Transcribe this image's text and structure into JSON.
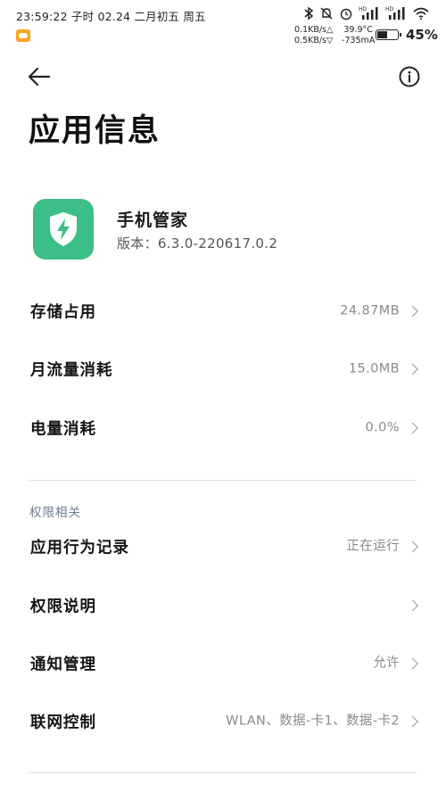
{
  "status_bar": {
    "datetime": "23:59:22 子时 02.24 二月初五 周五",
    "upload_speed": "0.1KB/s△",
    "download_speed": "0.5KB/s▽",
    "temperature": "39.9°C",
    "current": "-735mA",
    "battery_percent": "45%",
    "battery_level": 0.45,
    "icons": [
      "bluetooth-icon",
      "mute-icon",
      "alarm-icon",
      "hd-signal-icon",
      "hd-signal-icon",
      "wifi-icon"
    ],
    "status_icon_labels": [
      "HD",
      "HD"
    ]
  },
  "header": {
    "title": "应用信息"
  },
  "app": {
    "name": "手机管家",
    "version": "版本：6.3.0-220617.0.2",
    "icon_color": "#3cbf86"
  },
  "usage_rows": [
    {
      "label": "存储占用",
      "value": "24.87MB"
    },
    {
      "label": "月流量消耗",
      "value": "15.0MB"
    },
    {
      "label": "电量消耗",
      "value": "0.0%"
    }
  ],
  "permissions_section": {
    "title": "权限相关",
    "rows": [
      {
        "label": "应用行为记录",
        "value": "正在运行"
      },
      {
        "label": "权限说明",
        "value": ""
      },
      {
        "label": "通知管理",
        "value": "允许"
      },
      {
        "label": "联网控制",
        "value": "WLAN、数据-卡1、数据-卡2"
      }
    ]
  }
}
